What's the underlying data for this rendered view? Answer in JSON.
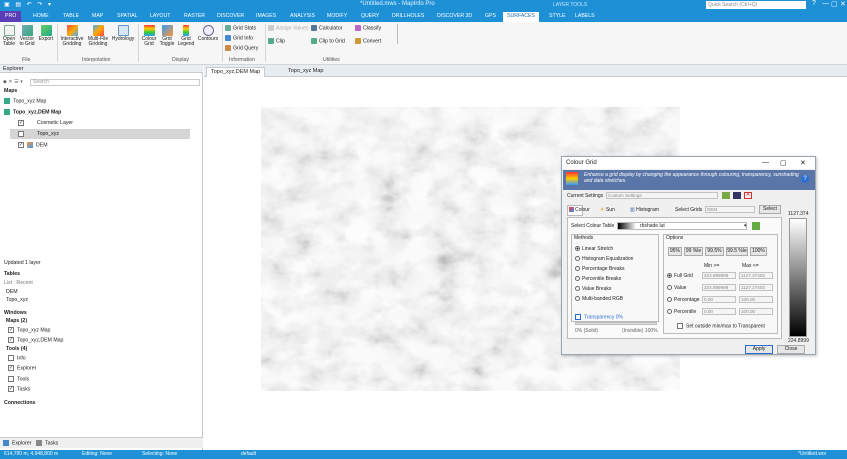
{
  "app": {
    "title": "*Untitled.mws - MapInfo Pro",
    "context_tab": "LAYER TOOLS",
    "search_placeholder": "Quick Search (Ctrl+Q)",
    "quick_access": "▣ ▤ ↶ ↷ ▾",
    "window_controls": {
      "help": "?",
      "minimize": "—",
      "restore": "▢",
      "close": "✕"
    }
  },
  "tabs": [
    "PRO",
    "HOME",
    "TABLE",
    "MAP",
    "SPATIAL",
    "LAYOUT",
    "RASTER",
    "DISCOVER",
    "IMAGES",
    "ANALYSIS",
    "MODIFY",
    "QUERY",
    "DRILLHOLES",
    "DISCOVER 3D",
    "GPS",
    "SURFACES",
    "STYLE",
    "LABELS"
  ],
  "ribbon": {
    "file": {
      "open": "Open Table",
      "vector": "Vector to Grid",
      "export": "Export",
      "group": "File"
    },
    "interpolation": {
      "interactive": "Interactive Gridding",
      "multifile": "Multi-File Gridding",
      "hydrology": "Hydrology",
      "group": "Interpolation"
    },
    "display": {
      "colour": "Colour Grid",
      "toggle": "Grid Toggle",
      "legend": "Grid Legend",
      "contours": "Contours",
      "group": "Display"
    },
    "information": {
      "stats": "Grid Stats",
      "info": "Grid Info",
      "query": "Grid Query",
      "group": "Information"
    },
    "utilities": {
      "assign": "Assign Values",
      "clip": "Clip",
      "calculator": "Calculator",
      "clip_to_grid": "Clip to Grid",
      "classify": "Classify",
      "convert": "Convert",
      "group": "Utilities"
    }
  },
  "explorer": {
    "title": "Explorer",
    "search_placeholder": "Search",
    "maps_header": "Maps",
    "map1": "Topo_xyz Map",
    "map2": "Topo_xyz,DEM Map",
    "layer_cosmetic": "Cosmetic Layer",
    "layer_topo": "Topo_xyz",
    "layer_dem": "DEM",
    "updated": "Updated 1 layer",
    "tables_header": "Tables",
    "tables_sort": "List : Recent",
    "table1": "DEM",
    "table2": "Topo_xyz",
    "windows_header": "Windows",
    "maps_count": "Maps (2)",
    "win1": "Topo_xyz Map",
    "win2": "Topo_xyz,DEM Map",
    "tools_count": "Tools (4)",
    "tool1": "Info",
    "tool2": "Explorer",
    "tool3": "Tools",
    "tool4": "Tasks",
    "connections_header": "Connections",
    "tab_explorer": "Explorer",
    "tab_tasks": "Tasks"
  },
  "doc_tabs": {
    "active": "Topo_xyz,DEM Map",
    "second": "Topo_xyz Map"
  },
  "dialog": {
    "title": "Colour Grid",
    "description": "Enhance a grid display by changing the appearance through colouring, transparency, sunshading and data stretches.",
    "current_settings_label": "Current Settings",
    "current_settings_value": "Custom Settings",
    "tab_colour": "Colour",
    "tab_sun": "Sun",
    "tab_histogram": "Histogram",
    "select_grids_label": "Select Grids",
    "select_grids_value": "DEM",
    "select_button": "Select",
    "colour_table_label": "Select Colour Table",
    "colour_table_value": "rbshade.lut",
    "methods_header": "Methods",
    "methods": [
      "Linear Stretch",
      "Histogram Equalization",
      "Percentage Breaks",
      "Percentile Breaks",
      "Value Breaks",
      "Multi-banded RGB"
    ],
    "transparency_label": "Transparency 0%",
    "solid_label": "0% (Solid)",
    "invisible_label": "(Invisible) 100%",
    "options_header": "Options",
    "pct_buttons": [
      "95%",
      "99 %le",
      "99.5%",
      "99.5 %le",
      "100%"
    ],
    "min_header": "Min >=",
    "max_header": "Max <=",
    "option_rows": [
      {
        "label": "Full Grid",
        "min": "224.899999",
        "max": "1127.37402"
      },
      {
        "label": "Value",
        "min": "224.899999",
        "max": "1127.37402"
      },
      {
        "label": "Percentage",
        "min": "0.00",
        "max": "100.00"
      },
      {
        "label": "Percentile",
        "min": "0.00",
        "max": "100.00"
      }
    ],
    "clip_label": "Set outside min/max to Transparent",
    "legend_max": "1127.374",
    "legend_min": "224.8999",
    "apply": "Apply",
    "close": "Close",
    "win_controls": {
      "minimize": "—",
      "maximize": "▢",
      "close": "✕"
    }
  },
  "status": {
    "coords": "614,790 m, 4,948,800 m",
    "editing": "Editing: None",
    "selecting": "Selecting: None",
    "projection": "default",
    "workspace": "*Untitled.wor"
  },
  "colors": {
    "accent": "#1e90d6",
    "pro": "#5b3db8"
  }
}
